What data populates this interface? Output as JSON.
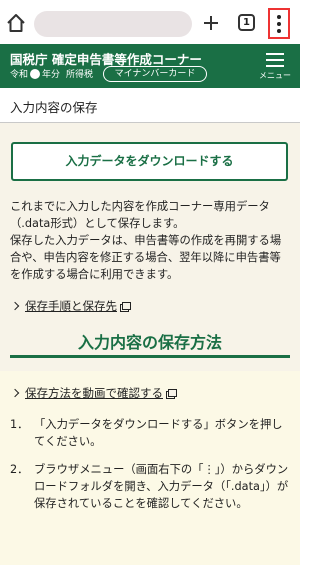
{
  "browser": {
    "tab_count": "1"
  },
  "header": {
    "title": "国税庁 確定申告書等作成コーナー",
    "era_prefix": "令和",
    "era_suffix": "年分",
    "tax_type": "所得税",
    "mynumber_card": "マイナンバーカード",
    "menu_label": "メニュー"
  },
  "page": {
    "title": "入力内容の保存"
  },
  "main": {
    "download_button": "入力データをダウンロードする",
    "description_1": "これまでに入力した内容を作成コーナー専用データ（.data形式）として保存します。",
    "description_2": "保存した入力データは、申告書等の作成を再開する場合や、申告内容を修正する場合、翌年以降に申告書等を作成する場合に利用できます。",
    "link_save_procedure": "保存手順と保存先",
    "section_title": "入力内容の保存方法",
    "link_video": "保存方法を動画で確認する",
    "steps": [
      {
        "num": "1．",
        "text": "「入力データをダウンロードする」ボタンを押してください。"
      },
      {
        "num": "2．",
        "text": "ブラウザメニュー（画面右下の「⋮」）からダウンロードフォルダを開き、入力データ（「.data」）が保存されていることを確認してください。"
      }
    ]
  }
}
